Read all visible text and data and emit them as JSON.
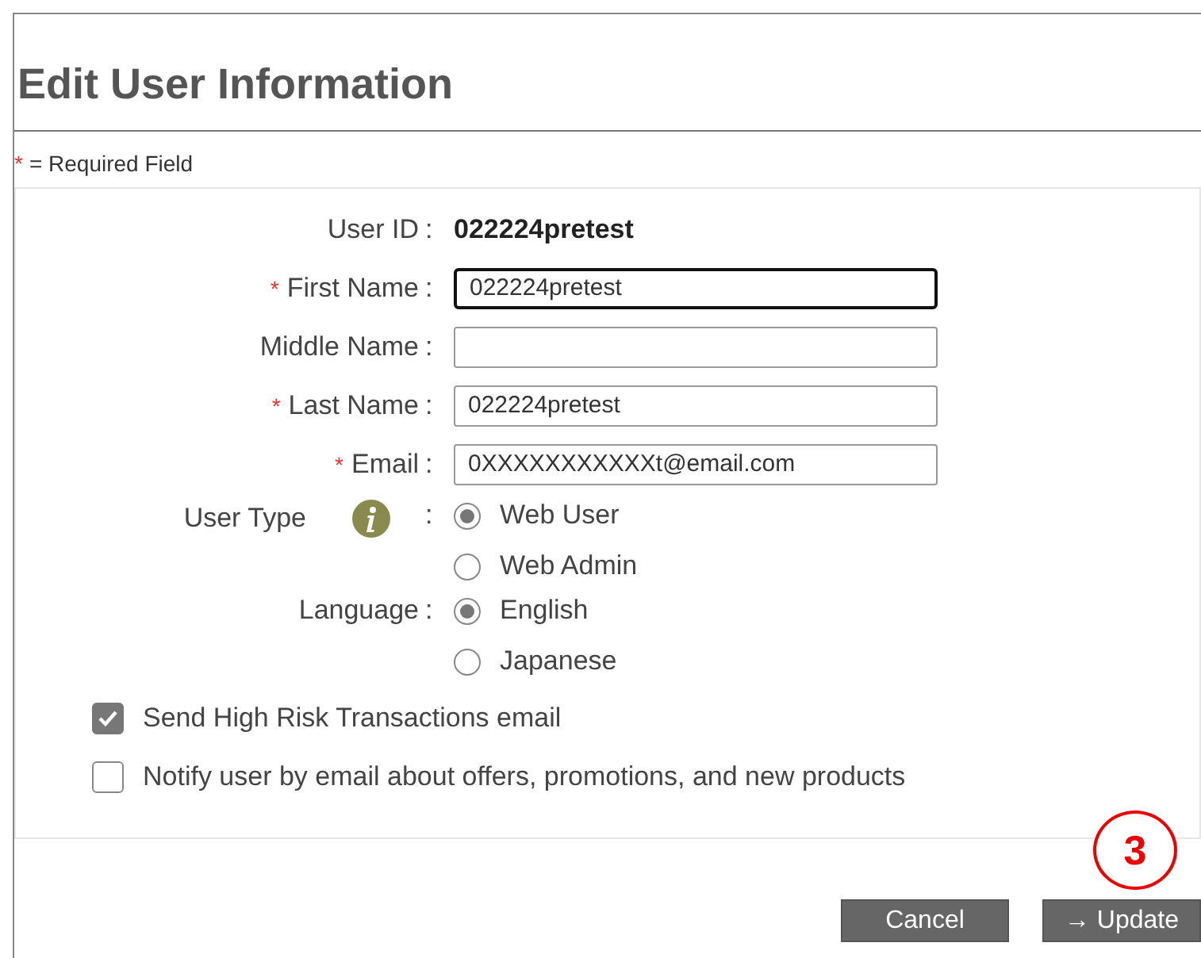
{
  "title": "Edit User Information",
  "required_note": {
    "marker": "*",
    "text": "= Required Field"
  },
  "required_marker": "*",
  "fields": [
    {
      "kind": "text",
      "label": "User ID",
      "separator": ":",
      "value": "022224pretest"
    },
    {
      "kind": "input",
      "label": "First Name",
      "separator": ":",
      "required": true,
      "value": "022224pretest",
      "focused": true
    },
    {
      "kind": "input",
      "label": "Middle Name",
      "separator": ":",
      "focused": false
    },
    {
      "kind": "input",
      "label": "Last Name",
      "separator": ":",
      "required": true,
      "value": "022224pretest",
      "focused": false
    },
    {
      "kind": "input",
      "label": "Email",
      "separator": ":",
      "required": true,
      "value": "0XXXXXXXXXXXt@email.com",
      "focused": false
    },
    {
      "kind": "radio",
      "label": "User Type",
      "separator": ":",
      "info": true,
      "options": [
        {
          "label": "Web User",
          "selected": true
        },
        {
          "label": "Web Admin",
          "selected": false
        }
      ]
    },
    {
      "kind": "radio",
      "label": "Language",
      "separator": ":",
      "options": [
        {
          "label": "English",
          "selected": true
        },
        {
          "label": "Japanese",
          "selected": false
        }
      ]
    }
  ],
  "checkboxes": [
    {
      "label": "Send High Risk Transactions email",
      "checked": true
    },
    {
      "label": "Notify user by email about offers, promotions, and new products",
      "checked": false
    }
  ],
  "buttons": [
    {
      "label": "Cancel"
    },
    {
      "label": "→ Update"
    }
  ],
  "step_marker": "3"
}
